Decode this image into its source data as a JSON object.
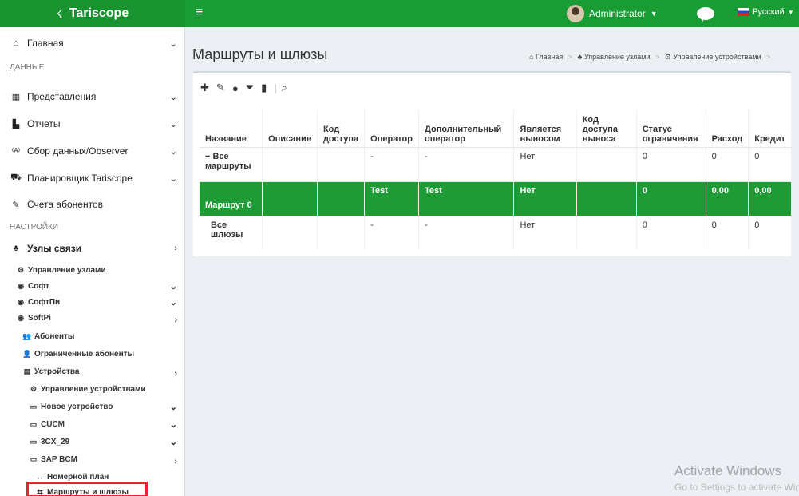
{
  "topbar": {
    "brand": "Tariscope",
    "menu_icon": "hamburger-icon",
    "user": "Administrator",
    "language": "Русский",
    "colors": {
      "bar": "#1a9c35",
      "selected_row": "#1e9b35"
    }
  },
  "sidebar": {
    "main": "Главная",
    "section_data": "ДАННЫЕ",
    "views": "Представления",
    "reports": "Отчеты",
    "collect": "Сбор данных/Observer",
    "scheduler": "Планировщик Tariscope",
    "accounts": "Счета абонентов",
    "section_settings": "НАСТРОЙКИ",
    "nodes": "Узлы связи",
    "node_management": "Управление узлами",
    "soft": "Софт",
    "softpi_ru": "СофтПи",
    "softpi": "SoftPi",
    "subscribers": "Абоненты",
    "restricted": "Ограниченные абоненты",
    "devices": "Устройства",
    "device_management": "Управление устройствами",
    "new_device": "Новое устройство",
    "cucm": "CUCM",
    "cx29": "3CX_29",
    "sapbcm": "SAP BCM",
    "dialplan": "Номерной план",
    "routes": "Маршруты и шлюзы"
  },
  "page": {
    "title": "Маршруты и шлюзы",
    "breadcrumb": [
      "Главная",
      "Управление узлами",
      "Управление устройствами"
    ]
  },
  "table": {
    "headers": {
      "name": "Название",
      "desc": "Описание",
      "code1": "Код",
      "code2": "доступа",
      "op": "Оператор",
      "addop1": "Дополнительный",
      "addop2": "оператор",
      "isout1": "Является",
      "isout2": "выносом",
      "outcode1": "Код доступа",
      "outcode2": "выноса",
      "status1": "Статус",
      "status2": "ограничения",
      "expense": "Расход",
      "credit": "Кредит"
    },
    "rows": [
      {
        "prefix": "−",
        "name1": "Все",
        "name2": "маршруты",
        "desc": "",
        "code": "",
        "op": "-",
        "addop": "-",
        "isout": "Нет",
        "outcode": "",
        "status": "0",
        "expense": "0",
        "credit": "0"
      },
      {
        "prefix": "",
        "name1": "Маршрут 0",
        "name2": "",
        "desc": "",
        "code": "",
        "op": "Test",
        "addop": "Test",
        "isout": "Нет",
        "outcode": "",
        "status": "0",
        "expense": "0,00",
        "credit": "0,00"
      },
      {
        "prefix": "",
        "name1": "Все",
        "name2": "шлюзы",
        "desc": "",
        "code": "",
        "op": "-",
        "addop": "-",
        "isout": "Нет",
        "outcode": "",
        "status": "0",
        "expense": "0",
        "credit": "0"
      }
    ]
  },
  "watermark": {
    "line1": "Activate Windows",
    "line2": "Go to Settings to activate Windows."
  }
}
